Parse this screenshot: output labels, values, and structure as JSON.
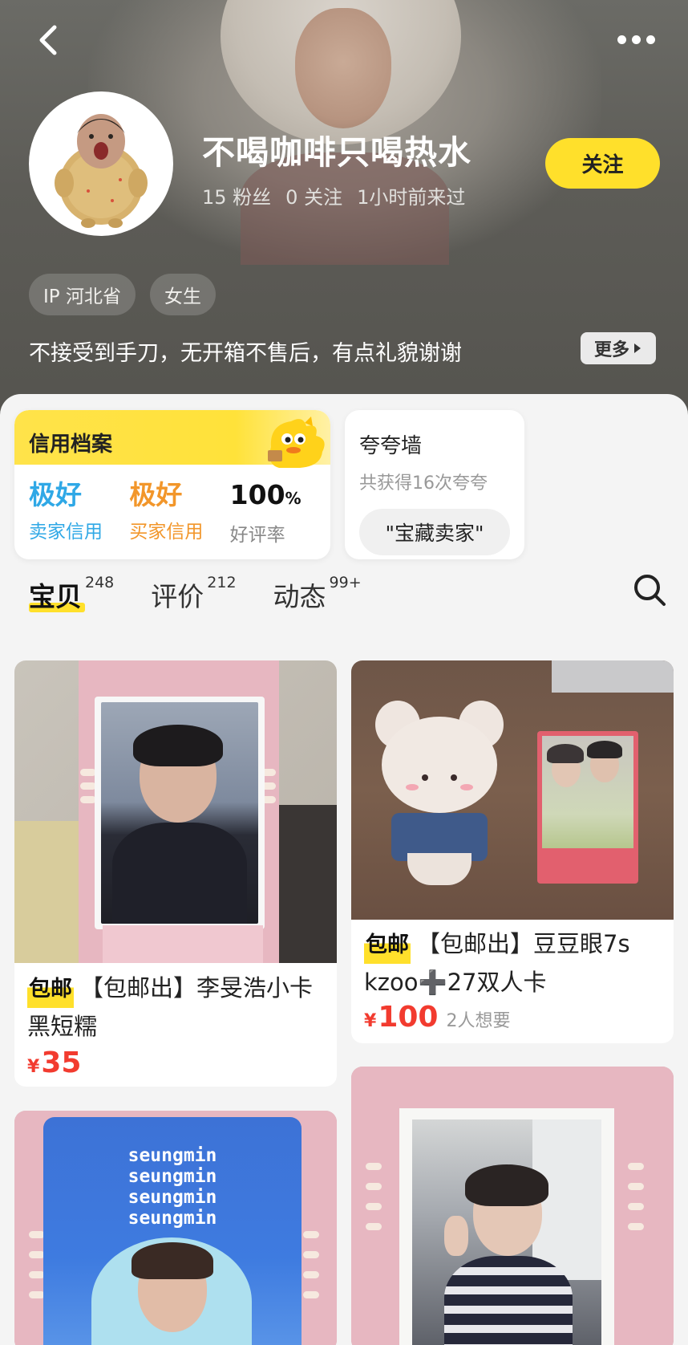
{
  "header": {
    "nickname": "不喝咖啡只喝热水",
    "fans": "15 粉丝",
    "following": "0 关注",
    "last_seen": "1小时前来过",
    "follow_label": "关注",
    "tags": [
      "IP 河北省",
      "女生"
    ],
    "bio": "不接受到手刀，无开箱不售后，有点礼貌谢谢",
    "bio_more": "更多"
  },
  "credit": {
    "title": "信用档案",
    "items": [
      {
        "value": "极好",
        "label": "卖家信用",
        "color": "#2fa8e6"
      },
      {
        "value": "极好",
        "label": "买家信用",
        "color": "#f2962a"
      },
      {
        "value": "100",
        "suffix": "%",
        "label": "好评率",
        "color": "#111111"
      }
    ]
  },
  "praise": {
    "title": "夸夸墙",
    "subtitle": "共获得16次夸夸",
    "chip": "\"宝藏卖家\""
  },
  "tabs": [
    {
      "label": "宝贝",
      "count": "248",
      "active": true
    },
    {
      "label": "评价",
      "count": "212",
      "active": false
    },
    {
      "label": "动态",
      "count": "99+",
      "active": false
    }
  ],
  "products": [
    {
      "badge": "包邮",
      "title": "【包邮出】李旻浩小卡 黑短糯",
      "price": "35",
      "want": ""
    },
    {
      "badge": "包邮",
      "title": "【包邮出】豆豆眼7s kzoo➕27双人卡",
      "price": "100",
      "want": "2人想要"
    },
    {
      "card_text": "seungmin",
      "badge": "",
      "title": "",
      "price": "",
      "want": ""
    },
    {
      "badge": "",
      "title": "",
      "price": "",
      "want": ""
    }
  ],
  "colors": {
    "accent_yellow": "#ffe02b",
    "price_red": "#f23b2f",
    "seller_blue": "#2fa8e6",
    "buyer_orange": "#f2962a"
  }
}
